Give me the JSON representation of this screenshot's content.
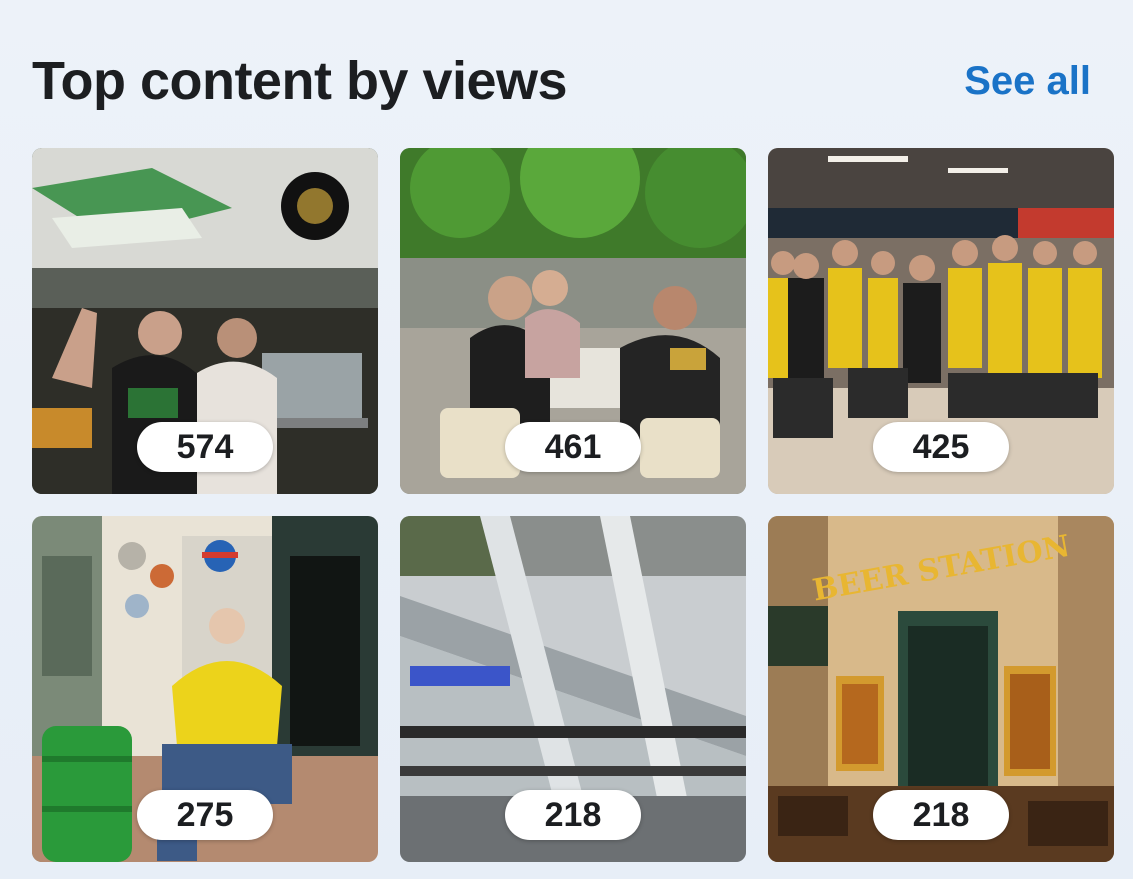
{
  "section": {
    "title": "Top content by views",
    "see_all_label": "See all"
  },
  "tiles": [
    {
      "views": "574",
      "image_icon": "photo-djs-bar-icon"
    },
    {
      "views": "461",
      "image_icon": "photo-terrace-group-icon"
    },
    {
      "views": "425",
      "image_icon": "photo-team-airport-icon"
    },
    {
      "views": "275",
      "image_icon": "photo-man-yellow-hoodie-icon"
    },
    {
      "views": "218",
      "image_icon": "photo-escalator-icon"
    },
    {
      "views": "218",
      "image_icon": "photo-beer-station-icon"
    }
  ],
  "photo_text": {
    "beer_station_sign": "BEER STATION"
  },
  "colors": {
    "title": "#1c1e21",
    "link": "#1a73c7",
    "background": "#eaf0f8",
    "badge": "#ffffff"
  }
}
